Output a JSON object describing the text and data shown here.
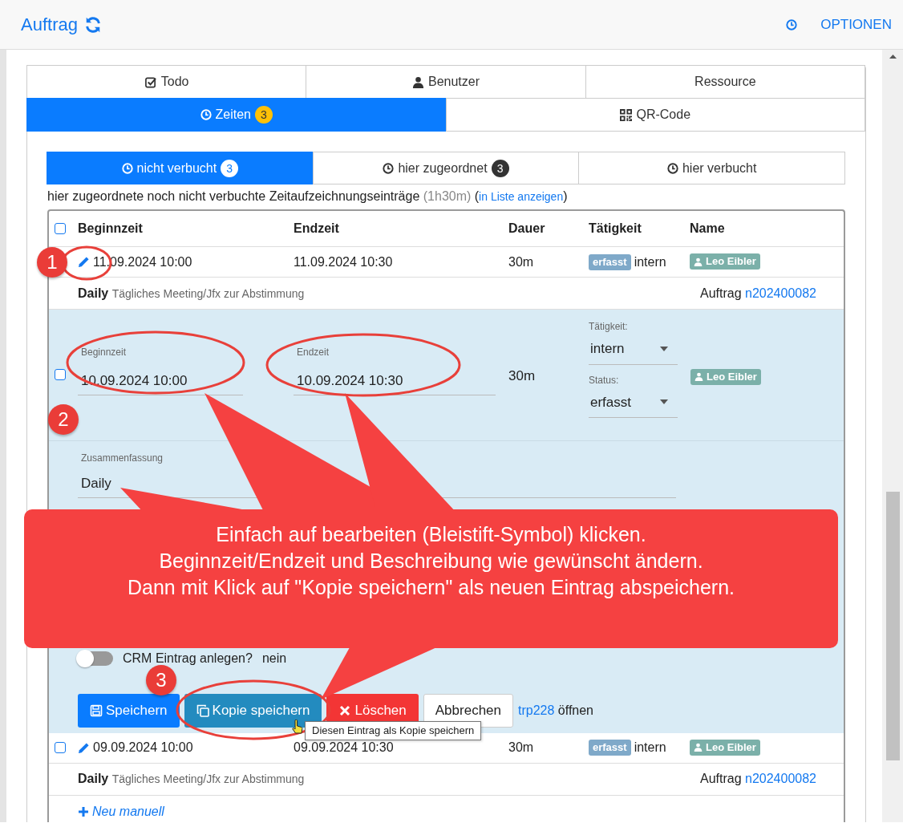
{
  "header": {
    "title": "Auftrag",
    "options": "OPTIONEN"
  },
  "tab_rows": [
    [
      {
        "label": "Todo",
        "selected": false
      },
      {
        "label": "Benutzer",
        "selected": false
      },
      {
        "label": "Ressource",
        "selected": false
      }
    ],
    [
      {
        "label": "Zeiten",
        "badge": "3",
        "selected": true
      },
      {
        "label": "QR-Code",
        "selected": false
      }
    ]
  ],
  "subtabs": [
    {
      "label": "nicht verbucht",
      "badge": "3",
      "selected": true
    },
    {
      "label": "hier zugeordnet",
      "badge": "3",
      "selected": false
    },
    {
      "label": "hier verbucht",
      "selected": false
    }
  ],
  "summary": {
    "text": "hier zugeordnete noch nicht verbuchte Zeitaufzeichnungseinträge",
    "duration": "(1h30m)",
    "before_link": "(",
    "link": "in Liste anzeigen",
    "after_link": ")"
  },
  "table": {
    "header_checked": false,
    "columns": [
      "Beginnzeit",
      "Endzeit",
      "Dauer",
      "Tätigkeit",
      "Name"
    ],
    "rows": [
      {
        "begin": "11.09.2024 10:00",
        "end": "11.09.2024 10:30",
        "duration": "30m",
        "status": "erfasst",
        "activity": "intern",
        "user": "Leo Eibler",
        "summary": "Daily",
        "detail": "Tägliches Meeting/Jfx zur Abstimmung",
        "order_label": "Auftrag",
        "order": "n202400082"
      },
      {
        "checked": false,
        "begin": "09.09.2024 10:00",
        "end": "09.09.2024 10:30",
        "duration": "30m",
        "status": "erfasst",
        "activity": "intern",
        "user": "Leo Eibler",
        "summary": "Daily",
        "detail": "Tägliches Meeting/Jfx zur Abstimmung",
        "order_label": "Auftrag",
        "order": "n202400082"
      }
    ]
  },
  "editor": {
    "checked": false,
    "begin_label": "Beginnzeit",
    "begin": "10.09.2024 10:00",
    "end_label": "Endzeit",
    "end": "10.09.2024 10:30",
    "duration": "30m",
    "activity_label": "Tätigkeit:",
    "activity": "intern",
    "status_label": "Status:",
    "status": "erfasst",
    "user": "Leo Eibler",
    "summary_label": "Zusammenfassung",
    "summary": "Daily",
    "crm_label": "CRM Eintrag anlegen?",
    "crm_on": false,
    "crm_value": "nein",
    "buttons": [
      {
        "kind": "save",
        "label": "Speichern"
      },
      {
        "kind": "copy",
        "label": "Kopie speichern"
      },
      {
        "kind": "delete",
        "label": "Löschen"
      },
      {
        "kind": "cancel",
        "label": "Abbrechen"
      }
    ],
    "link": "trp228",
    "link_suffix": "öffnen"
  },
  "new_link": "Neu manuell",
  "annotation": {
    "callout": [
      "Einfach auf bearbeiten (Bleistift-Symbol) klicken.",
      "Beginnzeit/Endzeit und Beschreibung wie gewünscht ändern.",
      "Dann mit Klick auf \"Kopie speichern\" als neuen Eintrag abspeichern."
    ],
    "markers": [
      "1",
      "2",
      "3"
    ],
    "tooltip": "Diesen Eintrag als Kopie speichern"
  }
}
